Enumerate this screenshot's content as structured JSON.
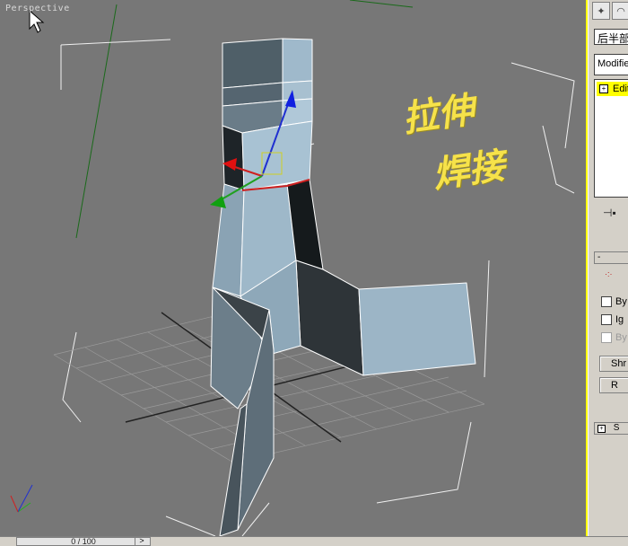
{
  "viewport": {
    "label": "Perspective",
    "annotation": {
      "line1": "拉伸",
      "line2": "焊接"
    }
  },
  "command_panel": {
    "object_name": "后半部",
    "modifier_list": "Modifier List",
    "stack_item": "Edit",
    "rollout_label": "-",
    "checkboxes": [
      {
        "label": "By",
        "enabled": true
      },
      {
        "label": "Ig",
        "enabled": true
      },
      {
        "label": "By",
        "enabled": false
      }
    ],
    "buttons": [
      "Shr",
      "R"
    ],
    "rollout2_label": "S",
    "icons": [
      "create-tab-icon",
      "modify-tab-icon",
      "pin-stack-icon"
    ]
  },
  "timebar": {
    "slider": "0 / 100",
    "next": ">"
  },
  "colors": {
    "viewport_bg": "#777777",
    "active_border": "#ffff00",
    "mesh": "#9ab3c4",
    "annotation": "#f6e24a"
  }
}
